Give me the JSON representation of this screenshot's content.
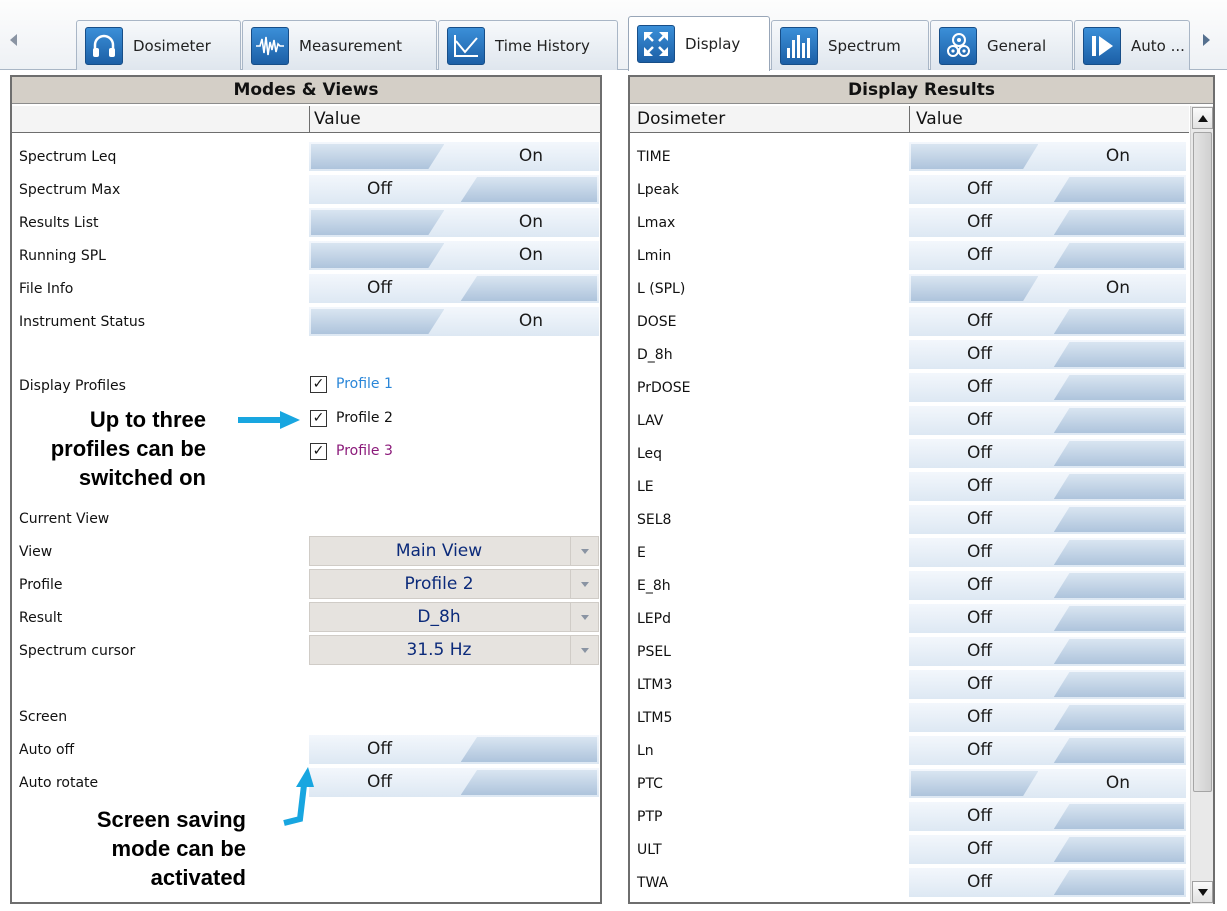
{
  "tabs": [
    {
      "label": "Dosimeter",
      "icon": "headphones-icon"
    },
    {
      "label": "Measurement",
      "icon": "waveform-icon"
    },
    {
      "label": "Time History",
      "icon": "line-chart-icon"
    },
    {
      "label": "Display",
      "icon": "expand-arrows-icon"
    },
    {
      "label": "Spectrum",
      "icon": "spectrum-bars-icon"
    },
    {
      "label": "General",
      "icon": "gears-icon"
    },
    {
      "label": "Auto ...",
      "icon": "play-icon"
    }
  ],
  "active_tab": "Display",
  "left": {
    "title": "Modes & Views",
    "value_header": "Value",
    "modes": [
      {
        "label": "Spectrum Leq",
        "value": "On"
      },
      {
        "label": "Spectrum Max",
        "value": "Off"
      },
      {
        "label": "Results List",
        "value": "On"
      },
      {
        "label": "Running SPL",
        "value": "On"
      },
      {
        "label": "File Info",
        "value": "Off"
      },
      {
        "label": "Instrument Status",
        "value": "On"
      }
    ],
    "display_profiles_label": "Display Profiles",
    "profiles": [
      {
        "label": "Profile 1",
        "checked": true,
        "color": "#2a86d8"
      },
      {
        "label": "Profile 2",
        "checked": true,
        "color": "#111111"
      },
      {
        "label": "Profile 3",
        "checked": true,
        "color": "#8b1a7a"
      }
    ],
    "check_mark": "✓",
    "current_view_label": "Current View",
    "current_view": [
      {
        "label": "View",
        "value": "Main View"
      },
      {
        "label": "Profile",
        "value": "Profile 2"
      },
      {
        "label": "Result",
        "value": "D_8h"
      },
      {
        "label": "Spectrum cursor",
        "value": "31.5 Hz"
      }
    ],
    "screen_label": "Screen",
    "screen": [
      {
        "label": "Auto off",
        "value": "Off"
      },
      {
        "label": "Auto rotate",
        "value": "Off"
      }
    ]
  },
  "annotations": {
    "profiles_note": [
      "Up to three",
      "profiles can be",
      "switched on"
    ],
    "screen_note": [
      "Screen saving",
      "mode can be",
      "activated"
    ],
    "arrow_color": "#18a6e0"
  },
  "right": {
    "title": "Display Results",
    "col1_header": "Dosimeter",
    "col2_header": "Value",
    "results": [
      {
        "label": "TIME",
        "value": "On"
      },
      {
        "label": "Lpeak",
        "value": "Off"
      },
      {
        "label": "Lmax",
        "value": "Off"
      },
      {
        "label": "Lmin",
        "value": "Off"
      },
      {
        "label": "L (SPL)",
        "value": "On"
      },
      {
        "label": "DOSE",
        "value": "Off"
      },
      {
        "label": "D_8h",
        "value": "Off"
      },
      {
        "label": "PrDOSE",
        "value": "Off"
      },
      {
        "label": "LAV",
        "value": "Off"
      },
      {
        "label": "Leq",
        "value": "Off"
      },
      {
        "label": "LE",
        "value": "Off"
      },
      {
        "label": "SEL8",
        "value": "Off"
      },
      {
        "label": "E",
        "value": "Off"
      },
      {
        "label": "E_8h",
        "value": "Off"
      },
      {
        "label": "LEPd",
        "value": "Off"
      },
      {
        "label": "PSEL",
        "value": "Off"
      },
      {
        "label": "LTM3",
        "value": "Off"
      },
      {
        "label": "LTM5",
        "value": "Off"
      },
      {
        "label": "Ln",
        "value": "Off"
      },
      {
        "label": "PTC",
        "value": "On"
      },
      {
        "label": "PTP",
        "value": "Off"
      },
      {
        "label": "ULT",
        "value": "Off"
      },
      {
        "label": "TWA",
        "value": "Off"
      }
    ]
  }
}
